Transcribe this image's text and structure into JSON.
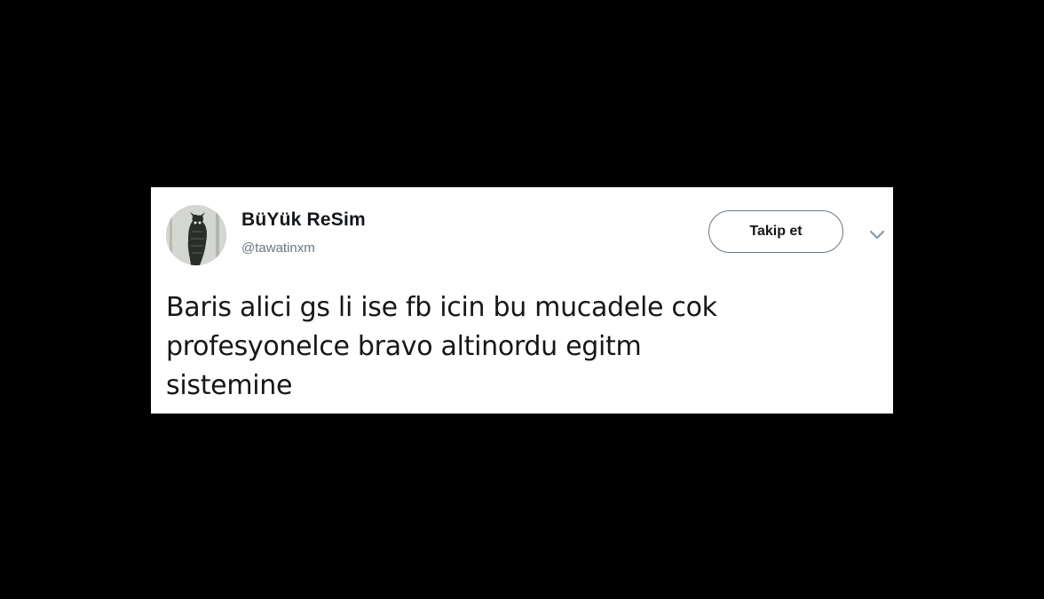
{
  "tweet": {
    "display_name": "BüYük ReSim",
    "handle": "@tawatinxm",
    "follow_label": "Takip et",
    "caret_icon": "chevron-down-icon",
    "text": "Baris alici gs li ise fb icin bu mucadele cok\nprofesyonelce bravo altinordu egitm\nsistemine"
  },
  "colors": {
    "background": "#000000",
    "card": "#ffffff",
    "text_primary": "#14171a",
    "text_secondary": "#657786"
  }
}
